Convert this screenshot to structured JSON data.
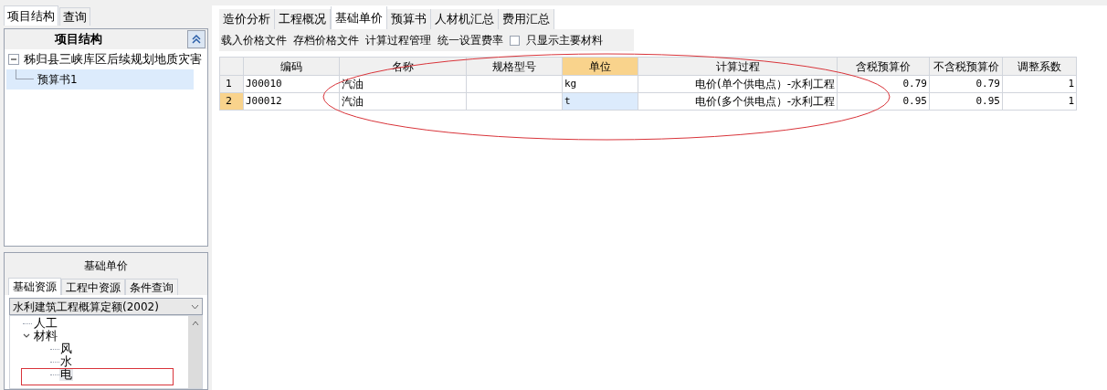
{
  "left_tabs": [
    {
      "label": "项目结构",
      "selected": true
    },
    {
      "label": "查询",
      "selected": false
    }
  ],
  "project_panel": {
    "title": "项目结构",
    "tree": [
      {
        "label": "秭归县三峡库区后续规划地质灾害",
        "expanded": true,
        "selected": false,
        "children": [
          {
            "label": "预算书1",
            "selected": true
          }
        ]
      }
    ]
  },
  "resource_panel": {
    "title": "基础单价",
    "tabs": [
      {
        "label": "基础资源",
        "selected": true
      },
      {
        "label": "工程中资源",
        "selected": false
      },
      {
        "label": "条件查询",
        "selected": false
      }
    ],
    "dropdown": "水利建筑工程概算定额(2002)",
    "tree": [
      {
        "label": "人工"
      },
      {
        "label": "材料",
        "expanded": true,
        "children": [
          {
            "label": "风",
            "selected": false
          },
          {
            "label": "水",
            "selected": false
          },
          {
            "label": "电",
            "selected": true
          }
        ]
      }
    ]
  },
  "main_tabs": [
    {
      "label": "造价分析",
      "selected": false
    },
    {
      "label": "工程概况",
      "selected": false
    },
    {
      "label": "基础单价",
      "selected": true
    },
    {
      "label": "预算书",
      "selected": false
    },
    {
      "label": "人材机汇总",
      "selected": false
    },
    {
      "label": "费用汇总",
      "selected": false
    }
  ],
  "toolbar": [
    {
      "kind": "button",
      "label": "载入价格文件"
    },
    {
      "kind": "button",
      "label": "存档价格文件"
    },
    {
      "kind": "button",
      "label": "计算过程管理"
    },
    {
      "kind": "button",
      "label": "统一设置费率"
    },
    {
      "kind": "checkbox",
      "label": "只显示主要材料",
      "checked": false
    }
  ],
  "table": {
    "columns": [
      {
        "label": "编码",
        "selected": false
      },
      {
        "label": "名称",
        "selected": false
      },
      {
        "label": "规格型号",
        "selected": false
      },
      {
        "label": "单位",
        "selected": true
      },
      {
        "label": "计算过程",
        "selected": false
      },
      {
        "label": "含税预算价",
        "selected": false
      },
      {
        "label": "不含税预算价",
        "selected": false
      },
      {
        "label": "调整系数",
        "selected": false
      }
    ],
    "rows": [
      {
        "number": "1",
        "selected": false,
        "cells": [
          "J00010",
          "汽油",
          "",
          "kg",
          "电价(单个供电点）-水利工程",
          "0.79",
          "0.79",
          "1"
        ]
      },
      {
        "number": "2",
        "selected": true,
        "cells": [
          "J00012",
          "汽油",
          "",
          "t",
          "电价(多个供电点）-水利工程",
          "0.95",
          "0.95",
          "1"
        ]
      }
    ]
  }
}
